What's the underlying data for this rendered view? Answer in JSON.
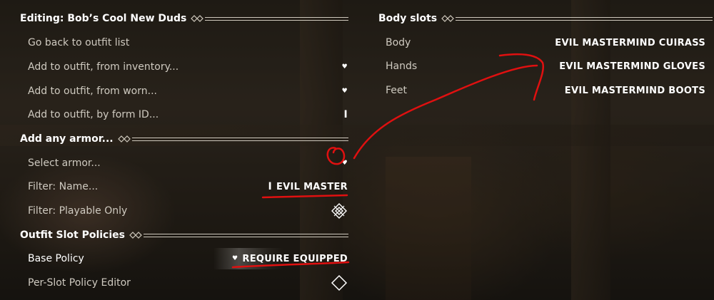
{
  "left": {
    "editing_header": "Editing: Bob’s Cool New Duds",
    "items": [
      {
        "label": "Go back to outfit list",
        "control": ""
      },
      {
        "label": "Add to outfit, from inventory...",
        "control": "dropdown"
      },
      {
        "label": "Add to outfit, from worn...",
        "control": "dropdown"
      },
      {
        "label": "Add to outfit, by form ID...",
        "control": "text"
      }
    ],
    "armor_header": "Add any armor...",
    "armor_items": [
      {
        "label": "Select armor...",
        "control": "dropdown"
      },
      {
        "label": "Filter: Name...",
        "value": "EVIL MASTER"
      },
      {
        "label": "Filter: Playable Only",
        "control": "checkbox"
      }
    ],
    "policy_header": "Outfit Slot Policies",
    "policy_items": [
      {
        "label": "Base Policy",
        "value": "REQUIRE EQUIPPED"
      },
      {
        "label": "Per-Slot Policy Editor",
        "control": "diamond"
      }
    ]
  },
  "right": {
    "header": "Body slots",
    "slots": [
      {
        "label": "Body",
        "value": "EVIL MASTERMIND CUIRASS"
      },
      {
        "label": "Hands",
        "value": "EVIL MASTERMIND GLOVES"
      },
      {
        "label": "Feet",
        "value": "EVIL MASTERMIND BOOTS"
      }
    ]
  },
  "icons": {
    "header_ornament": "double-diamond-ornament-icon",
    "dropdown": "dropdown-dot-icon",
    "text_input": "text-cursor-icon",
    "checkbox": "ornate-checkbox-icon",
    "diamond": "diamond-option-icon"
  },
  "colors": {
    "annotation": "#e01010",
    "text_primary": "#ffffff",
    "text_secondary": "#cfcac0"
  }
}
